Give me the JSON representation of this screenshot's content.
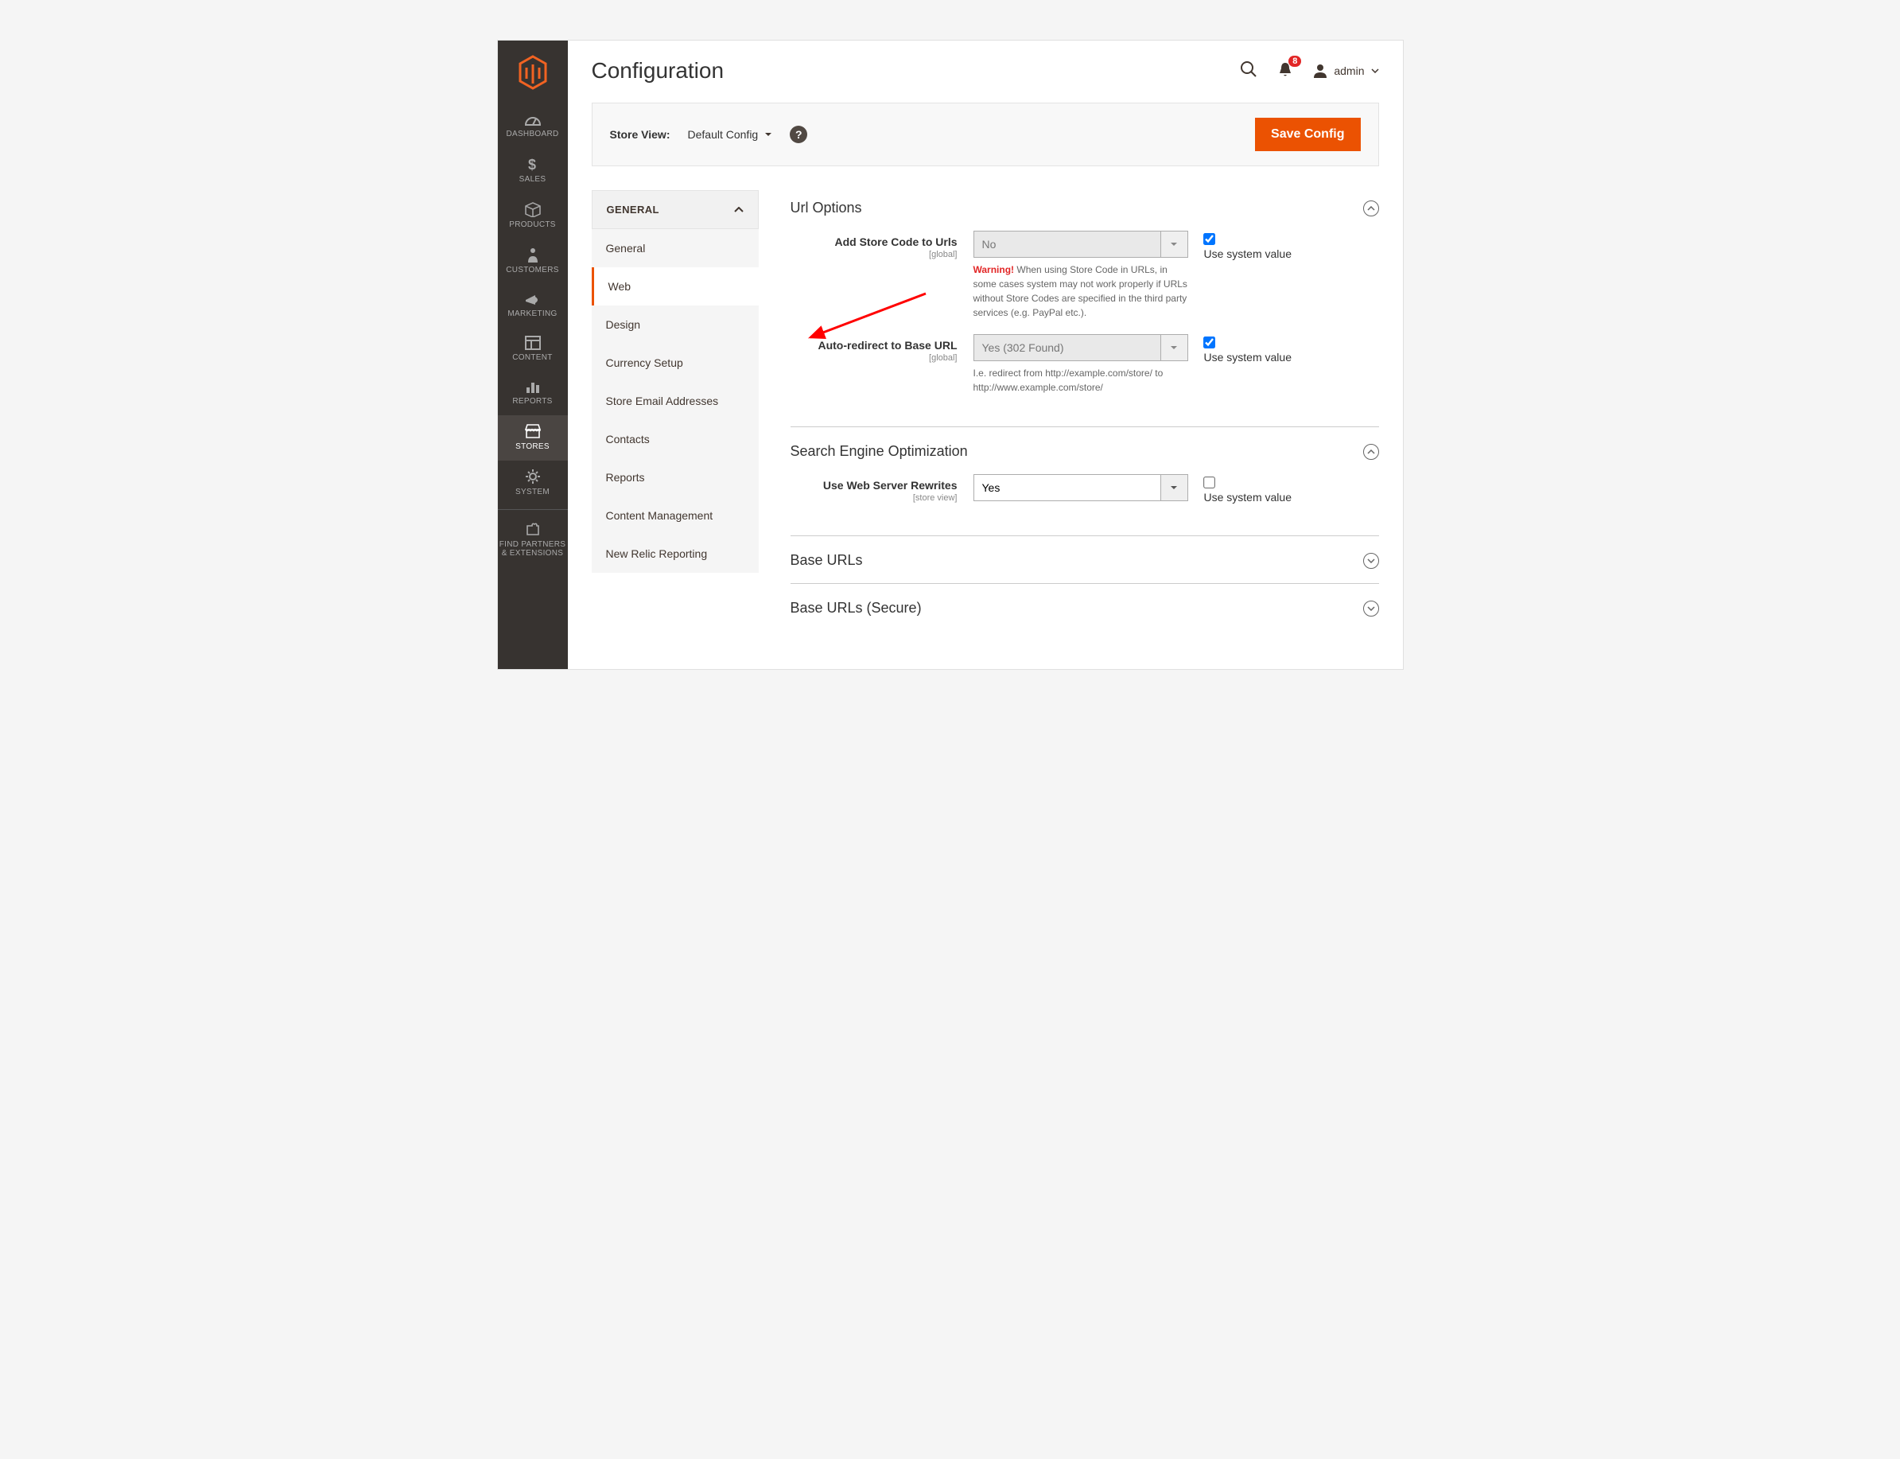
{
  "sidebar": {
    "items": [
      {
        "label": "DASHBOARD"
      },
      {
        "label": "SALES"
      },
      {
        "label": "PRODUCTS"
      },
      {
        "label": "CUSTOMERS"
      },
      {
        "label": "MARKETING"
      },
      {
        "label": "CONTENT"
      },
      {
        "label": "REPORTS"
      },
      {
        "label": "STORES"
      },
      {
        "label": "SYSTEM"
      },
      {
        "label": "FIND PARTNERS & EXTENSIONS"
      }
    ]
  },
  "header": {
    "title": "Configuration",
    "notification_count": "8",
    "user": "admin"
  },
  "toolbar": {
    "store_view_label": "Store View:",
    "scope_value": "Default Config",
    "save_label": "Save Config"
  },
  "config_nav": {
    "group": "GENERAL",
    "items": [
      "General",
      "Web",
      "Design",
      "Currency Setup",
      "Store Email Addresses",
      "Contacts",
      "Reports",
      "Content Management",
      "New Relic Reporting"
    ],
    "active_index": 1
  },
  "sections": {
    "url_options": {
      "title": "Url Options",
      "fields": {
        "add_store_code": {
          "label": "Add Store Code to Urls",
          "scope": "[global]",
          "value": "No",
          "use_system": true,
          "warning_prefix": "Warning!",
          "warning_body": " When using Store Code in URLs, in some cases system may not work properly if URLs without Store Codes are specified in the third party services (e.g. PayPal etc.)."
        },
        "auto_redirect": {
          "label": "Auto-redirect to Base URL",
          "scope": "[global]",
          "value": "Yes (302 Found)",
          "use_system": true,
          "hint": "I.e. redirect from http://example.com/store/ to http://www.example.com/store/"
        }
      }
    },
    "seo": {
      "title": "Search Engine Optimization",
      "fields": {
        "rewrites": {
          "label": "Use Web Server Rewrites",
          "scope": "[store view]",
          "value": "Yes",
          "use_system": false
        }
      }
    },
    "base_urls": {
      "title": "Base URLs"
    },
    "base_urls_secure": {
      "title": "Base URLs (Secure)"
    }
  },
  "labels": {
    "use_system_value": "Use system value"
  }
}
